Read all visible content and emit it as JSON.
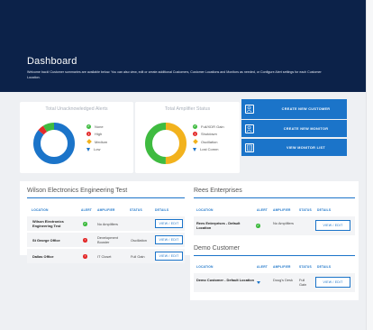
{
  "header": {
    "title": "Dashboard",
    "welcome": "Welcome back! Customer summaries are available below. You can also view, edit or create additional Customers, Customer Locations and Monitors as needed, or Configure Alert settings for each Customer Location."
  },
  "colors": {
    "navy": "#0c2249",
    "accent": "#1b74c9",
    "green": "#3fbb40",
    "red": "#e32b2b",
    "yellow": "#f2b21d"
  },
  "alerts_card": {
    "title": "Total Unacknowledged Alerts",
    "legend": [
      {
        "label": "None",
        "shape": "check-circle",
        "color": "#3fbb40"
      },
      {
        "label": "High",
        "shape": "exclamation-circle",
        "color": "#e32b2b"
      },
      {
        "label": "Medium",
        "shape": "diamond",
        "color": "#f2b21d"
      },
      {
        "label": "Low",
        "shape": "down-triangle",
        "color": "#1b74c9"
      }
    ],
    "donut_segments": [
      {
        "name": "Low",
        "value": 0.86,
        "color": "#1b74c9"
      },
      {
        "name": "High",
        "value": 0.05,
        "color": "#e32b2b"
      },
      {
        "name": "None",
        "value": 0.09,
        "color": "#3fbb40"
      }
    ]
  },
  "amplifier_card": {
    "title": "Total Amplifier Status",
    "legend": [
      {
        "label": "Full/XDR Gain",
        "shape": "check-circle",
        "color": "#3fbb40"
      },
      {
        "label": "Shutdown",
        "shape": "exclamation-circle",
        "color": "#e32b2b"
      },
      {
        "label": "Oscillation",
        "shape": "diamond",
        "color": "#f2b21d"
      },
      {
        "label": "Lost Comm",
        "shape": "down-triangle",
        "color": "#1b74c9"
      }
    ],
    "donut_segments": [
      {
        "name": "Oscillation",
        "value": 0.5,
        "color": "#f2b21d"
      },
      {
        "name": "Full/XDR Gain",
        "value": 0.5,
        "color": "#3fbb40"
      }
    ]
  },
  "actions": [
    {
      "label": "CREATE NEW CUSTOMER",
      "icon": "add-user-icon"
    },
    {
      "label": "CREATE NEW MONITOR",
      "icon": "add-monitor-icon"
    },
    {
      "label": "VIEW MONITOR LIST",
      "icon": "list-icon"
    }
  ],
  "columns": {
    "location": "LOCATION",
    "alert": "ALERT",
    "amplifier": "AMPLIFIER",
    "status": "STATUS",
    "details": "DETAILS"
  },
  "edit_label": "VIEW / EDIT",
  "customers": [
    {
      "name": "Wilson Electronics Engineering Test",
      "rows": [
        {
          "location": "Wilson Electronics Engineering Test",
          "alert": "none",
          "amplifier": "No Amplifiers",
          "status": ""
        },
        {
          "location": "St George Office",
          "alert": "high",
          "amplifier": "Development Booster",
          "status": "Oscillation"
        },
        {
          "location": "Dallas Office",
          "alert": "high",
          "amplifier": "IT Closet",
          "status": "Full Gain"
        }
      ]
    },
    {
      "name": "Rees Enterprises",
      "rows": [
        {
          "location": "Rees Enterprises - Default Location",
          "alert": "none",
          "amplifier": "No Amplifiers",
          "status": ""
        }
      ]
    },
    {
      "name": "Demo Customer",
      "rows": [
        {
          "location": "Demo Customer - Default Location",
          "alert": "low",
          "amplifier": "Doug's Desk",
          "status": "Full Gain"
        }
      ]
    }
  ]
}
